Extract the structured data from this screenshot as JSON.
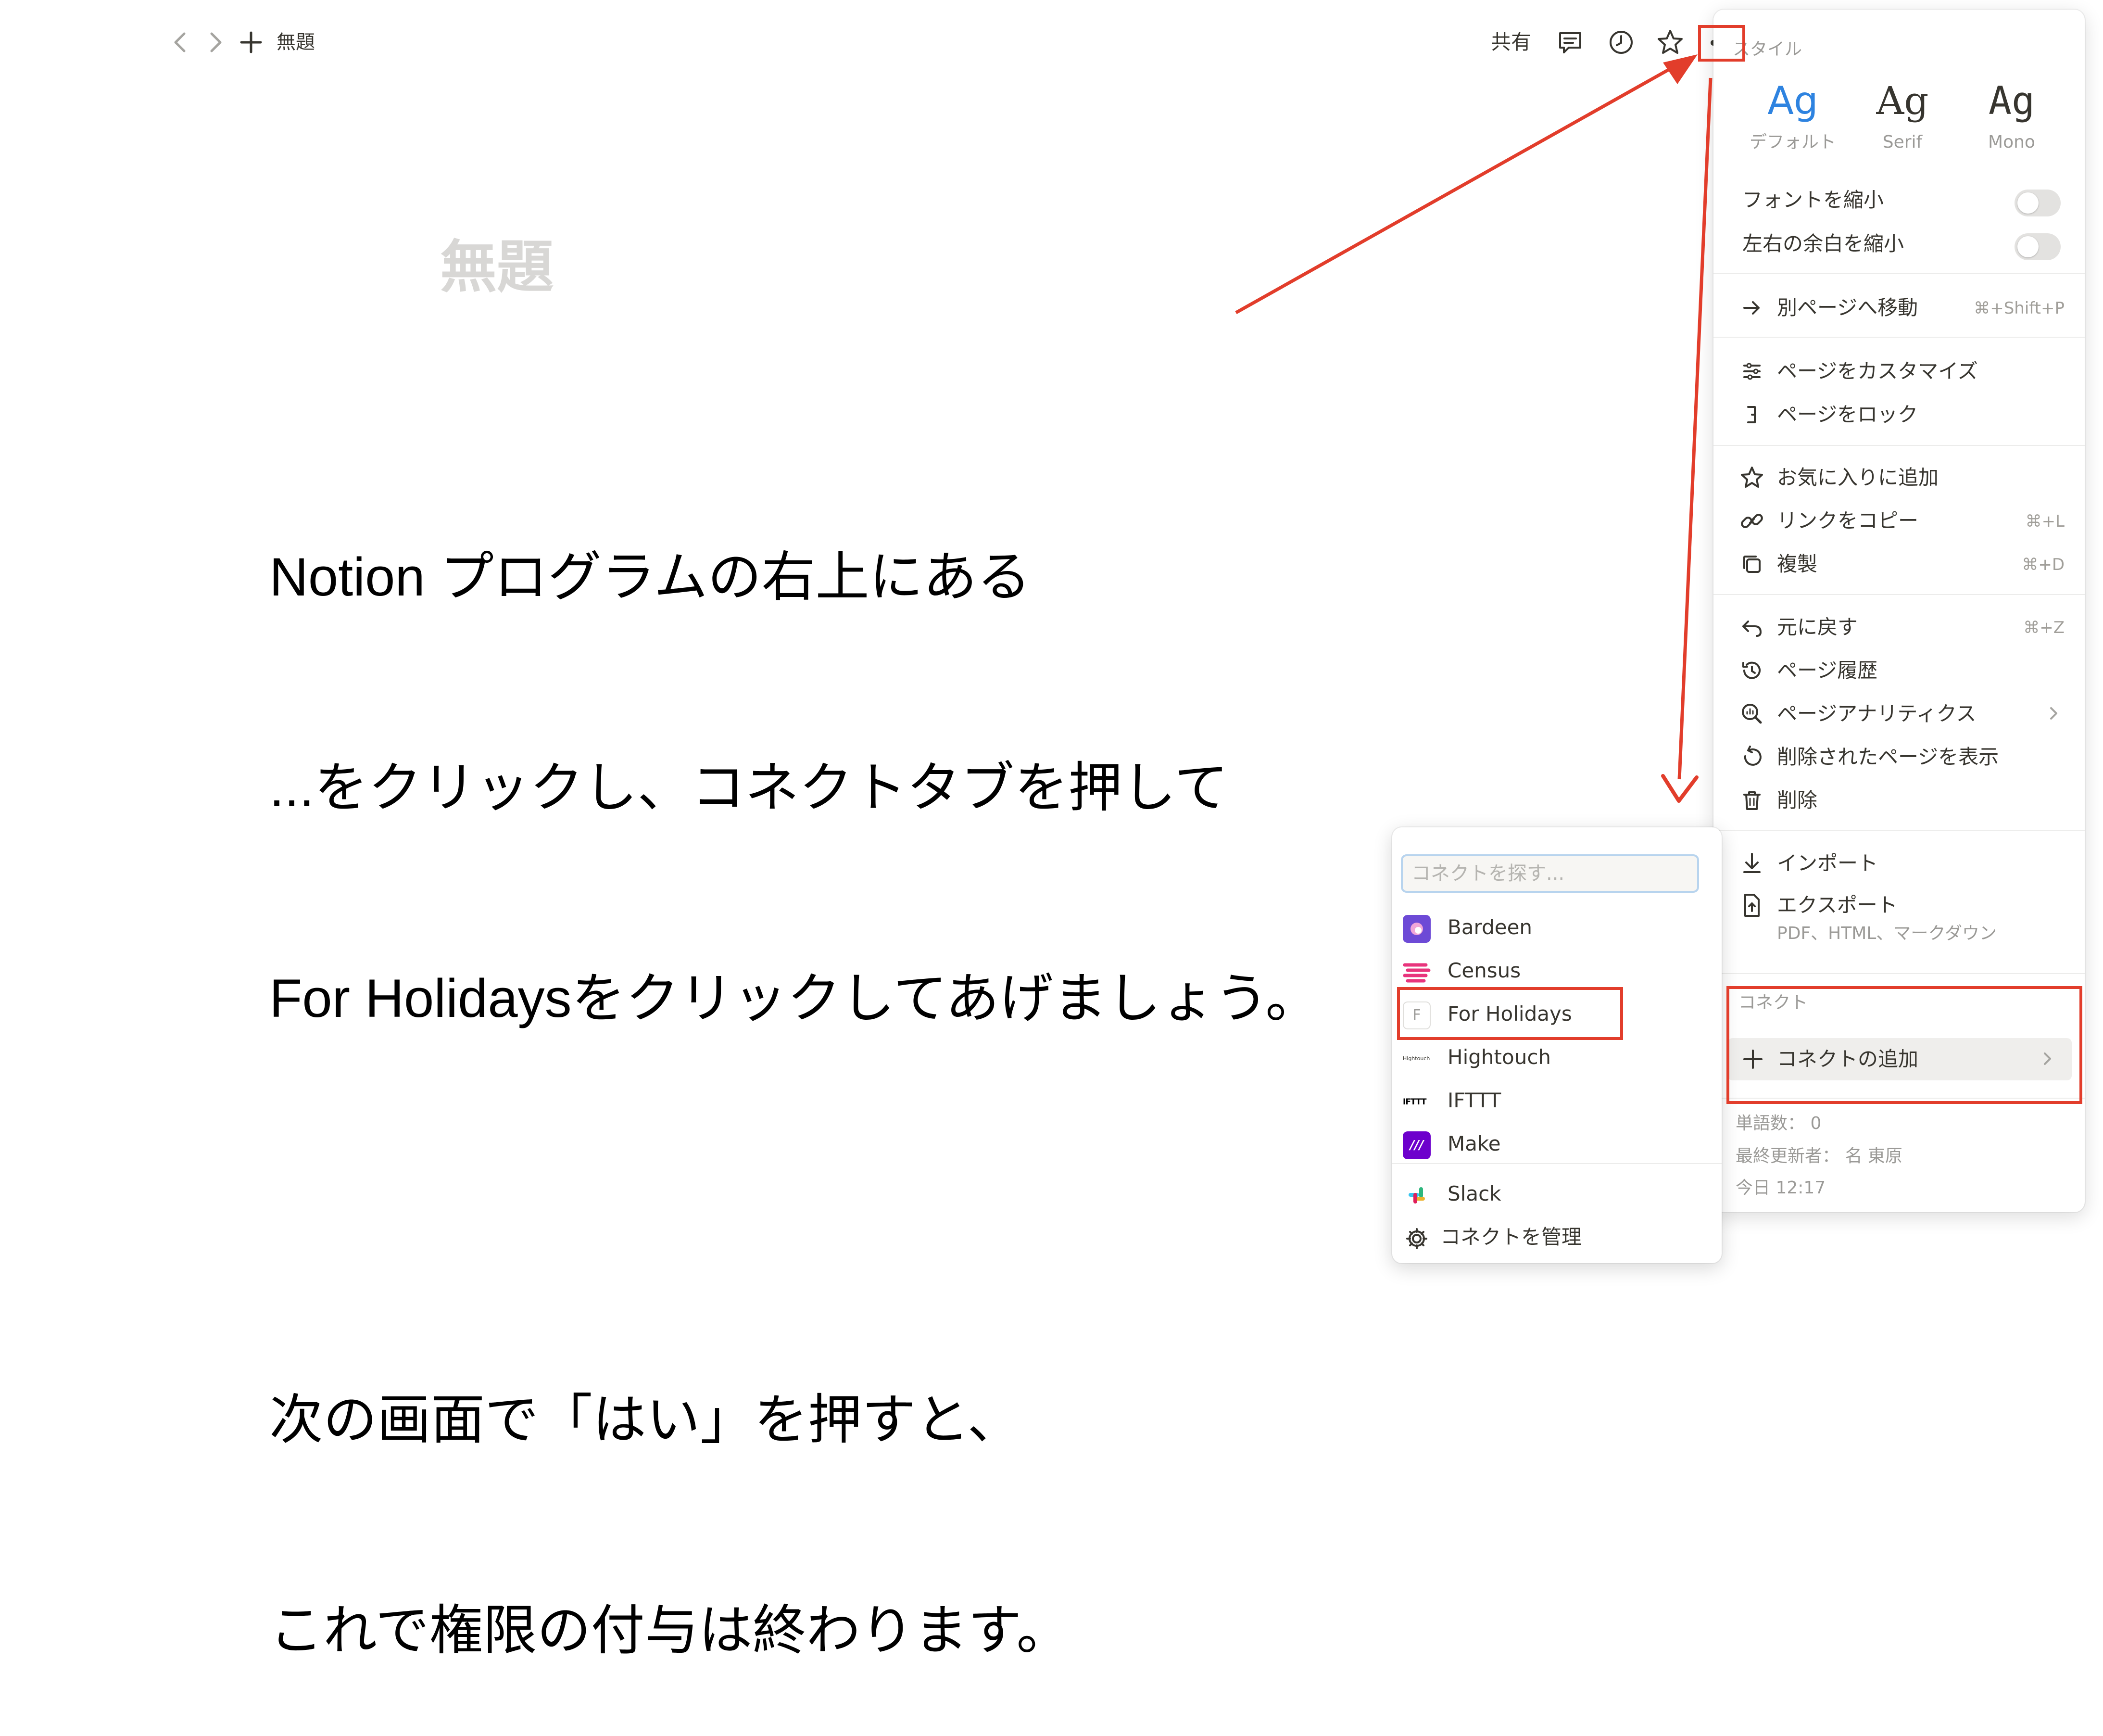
{
  "topbar": {
    "breadcrumb_title": "無題",
    "share_label": "共有",
    "icons": [
      "chevron-left-icon",
      "chevron-right-icon",
      "plus-icon",
      "comment-icon",
      "clock-icon",
      "star-icon",
      "more-icon"
    ]
  },
  "page": {
    "title": "無題"
  },
  "instruction": {
    "lines": [
      "Notion プログラムの右上にある",
      "...をクリックし、コネクトタブを押して",
      "For Holidaysをクリックしてあげましょう。",
      "",
      "次の画面で「はい」を押すと、",
      "これで権限の付与は終わります。"
    ]
  },
  "menu": {
    "style_heading": "スタイル",
    "style_options": [
      {
        "glyph": "Ag",
        "label": "デフォルト",
        "selected": true
      },
      {
        "glyph": "Ag",
        "label": "Serif"
      },
      {
        "glyph": "Ag",
        "label": "Mono"
      }
    ],
    "toggles": [
      {
        "label": "フォントを縮小",
        "on": false
      },
      {
        "label": "左右の余白を縮小",
        "on": false
      }
    ],
    "move_to": {
      "label": "別ページへ移動",
      "shortcut": "⌘+Shift+P"
    },
    "customize": {
      "label": "ページをカスタマイズ"
    },
    "lock": {
      "label": "ページをロック"
    },
    "favorite": {
      "label": "お気に入りに追加"
    },
    "copy_link": {
      "label": "リンクをコピー",
      "shortcut": "⌘+L"
    },
    "duplicate": {
      "label": "複製",
      "shortcut": "⌘+D"
    },
    "undo": {
      "label": "元に戻す",
      "shortcut": "⌘+Z"
    },
    "history": {
      "label": "ページ履歴"
    },
    "analytics": {
      "label": "ページアナリティクス"
    },
    "deleted_pages": {
      "label": "削除されたページを表示"
    },
    "delete": {
      "label": "削除"
    },
    "import": {
      "label": "インポート"
    },
    "export": {
      "label": "エクスポート",
      "sublabel": "PDF、HTML、マークダウン"
    },
    "connect_heading": "コネクト",
    "add_connect": {
      "label": "コネクトの追加"
    },
    "footer": {
      "word_count": "単語数： 0",
      "last_editor": "最終更新者： 名 東原",
      "time": "今日 12:17"
    }
  },
  "connect_popup": {
    "search_placeholder": "コネクトを探す...",
    "items": [
      {
        "label": "Bardeen",
        "logo_color": "#6d4ad6"
      },
      {
        "label": "Census",
        "logo_color": "#e8347c"
      },
      {
        "label": "For Holidays",
        "logo_letter": "F"
      },
      {
        "label": "Hightouch",
        "logo_text": "Hightouch"
      },
      {
        "label": "IFTTT",
        "logo_text": "IFTTT"
      },
      {
        "label": "Make",
        "logo_color": "#6d00cc",
        "logo_text": "///"
      },
      {
        "label": "Slack"
      }
    ],
    "manage_label": "コネクトを管理"
  },
  "colors": {
    "annotation_red": "#e23d2b",
    "accent_blue": "#2e83e0",
    "text": "#37352f",
    "muted": "#9b9a97"
  }
}
